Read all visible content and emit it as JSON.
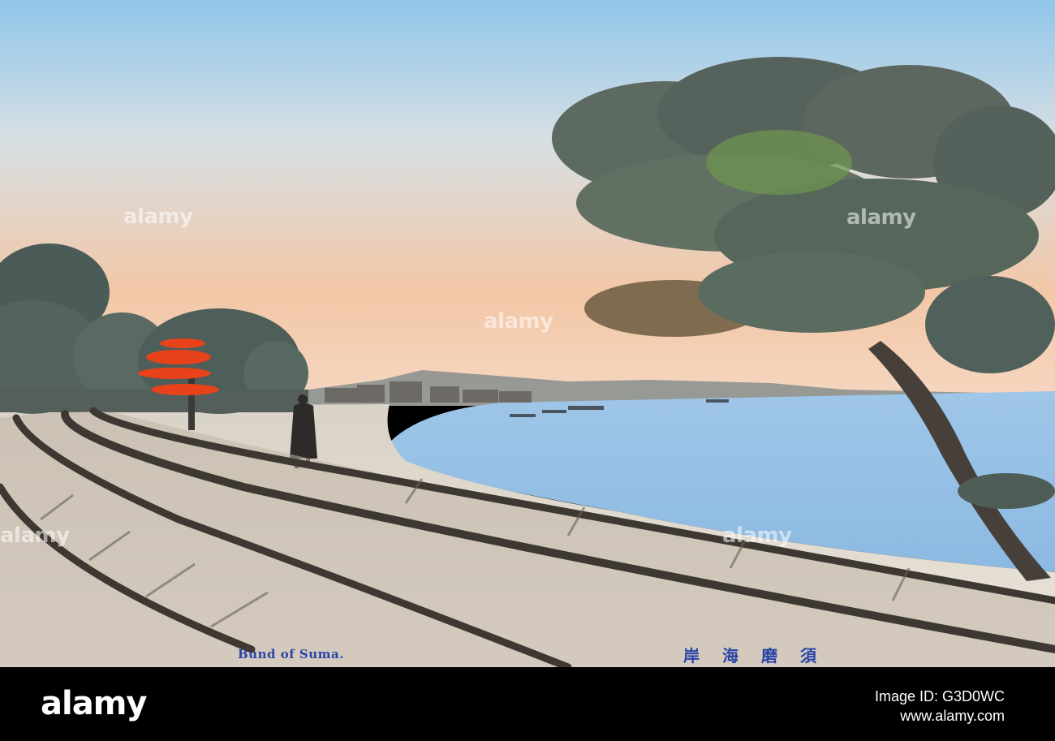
{
  "photo": {
    "caption_en": "Bund of Suma.",
    "caption_jp": "岸海磨須",
    "watermark_text": "alamy"
  },
  "footer": {
    "logo": "alamy",
    "image_id": "Image ID: G3D0WC",
    "url": "www.alamy.com"
  }
}
